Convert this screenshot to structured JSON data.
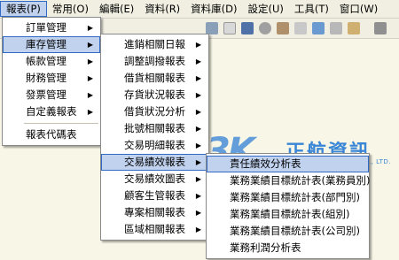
{
  "menubar": {
    "items": [
      "報表(P)",
      "常用(O)",
      "編輯(E)",
      "資料(R)",
      "資料庫(D)",
      "設定(U)",
      "工具(T)",
      "窗口(W)"
    ]
  },
  "menu_level1": {
    "items": [
      {
        "label": "訂單管理",
        "has_submenu": true
      },
      {
        "label": "庫存管理",
        "has_submenu": true,
        "highlighted": true
      },
      {
        "label": "帳款管理",
        "has_submenu": true
      },
      {
        "label": "財務管理",
        "has_submenu": true
      },
      {
        "label": "發票管理",
        "has_submenu": true
      },
      {
        "label": "自定義報表",
        "has_submenu": true
      },
      {
        "separator": true
      },
      {
        "label": "報表代碼表",
        "has_submenu": false
      }
    ]
  },
  "menu_level2": {
    "items": [
      {
        "label": "進銷相關日報"
      },
      {
        "label": "調整調撥報表"
      },
      {
        "label": "借貨相關報表"
      },
      {
        "label": "存貨狀況報表"
      },
      {
        "label": "借貨狀況分析"
      },
      {
        "label": "批號相關報表"
      },
      {
        "label": "交易明細報表"
      },
      {
        "label": "交易績效報表",
        "highlighted": true
      },
      {
        "label": "交易績效圖表"
      },
      {
        "label": "顧客生管報表"
      },
      {
        "label": "專案相關報表"
      },
      {
        "label": "區域相關報表"
      }
    ]
  },
  "menu_level3": {
    "items": [
      {
        "label": "責任績效分析表",
        "highlighted": true
      },
      {
        "label": "業務業績目標統計表(業務員別)"
      },
      {
        "label": "業務業績目標統計表(部門別)"
      },
      {
        "label": "業務業績目標統計表(組別)"
      },
      {
        "label": "業務業績目標統計表(公司別)"
      },
      {
        "label": "業務利潤分析表"
      }
    ]
  },
  "watermark": {
    "mark": "3K",
    "name": "正航資訊",
    "tagline": "INFO INFORMATION CO., LTD."
  },
  "colors": {
    "highlight_bg": "#c1d2ee",
    "highlight_border": "#316ac5",
    "logo_blue": "#3a86d6"
  }
}
